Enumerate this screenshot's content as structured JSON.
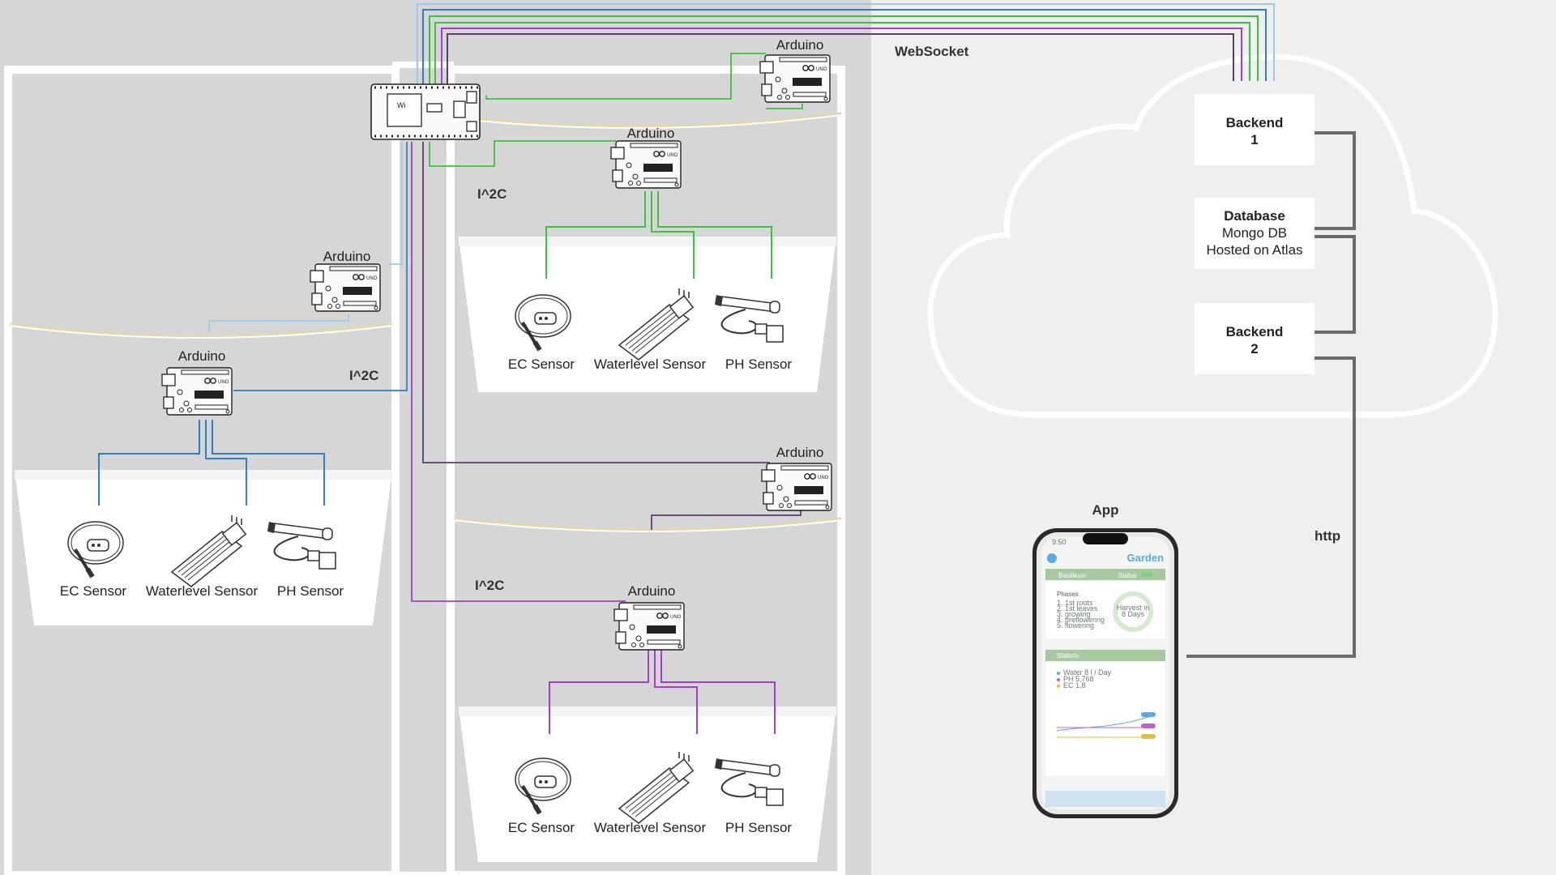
{
  "labels": {
    "websocket": "WebSocket",
    "http": "http",
    "app": "App",
    "i2c": "I^2C",
    "arduino": "Arduino"
  },
  "sensors": [
    "EC Sensor",
    "Waterlevel Sensor",
    "PH Sensor"
  ],
  "backend": {
    "b1_line1": "Backend",
    "b1_line2": "1",
    "db_line1": "Database",
    "db_line2": "Mongo DB",
    "db_line3": "Hosted on Atlas",
    "b2_line1": "Backend",
    "b2_line2": "2"
  },
  "phone": {
    "title": "Garden",
    "plant": "Basilikum",
    "status": "Status",
    "phases_title": "Phases",
    "phases": [
      "1. 1st roots",
      "2. 1st leaves",
      "3. growing",
      "4. preflowering",
      "5. flowering"
    ],
    "harvest_line1": "Harvest in",
    "harvest_line2": "8 Days",
    "statistic": "Statistic",
    "legend": [
      "Water  8 l / Day",
      "PH  5,768",
      "EC  1,8"
    ],
    "time": "9:50"
  },
  "colors": {
    "blue": "#2f7dd1",
    "light_blue": "#9cc8ee",
    "green": "#3cc23c",
    "purple": "#a23fcf",
    "dark_purple": "#5d3a6d",
    "grey_line": "#6b6b6b"
  }
}
